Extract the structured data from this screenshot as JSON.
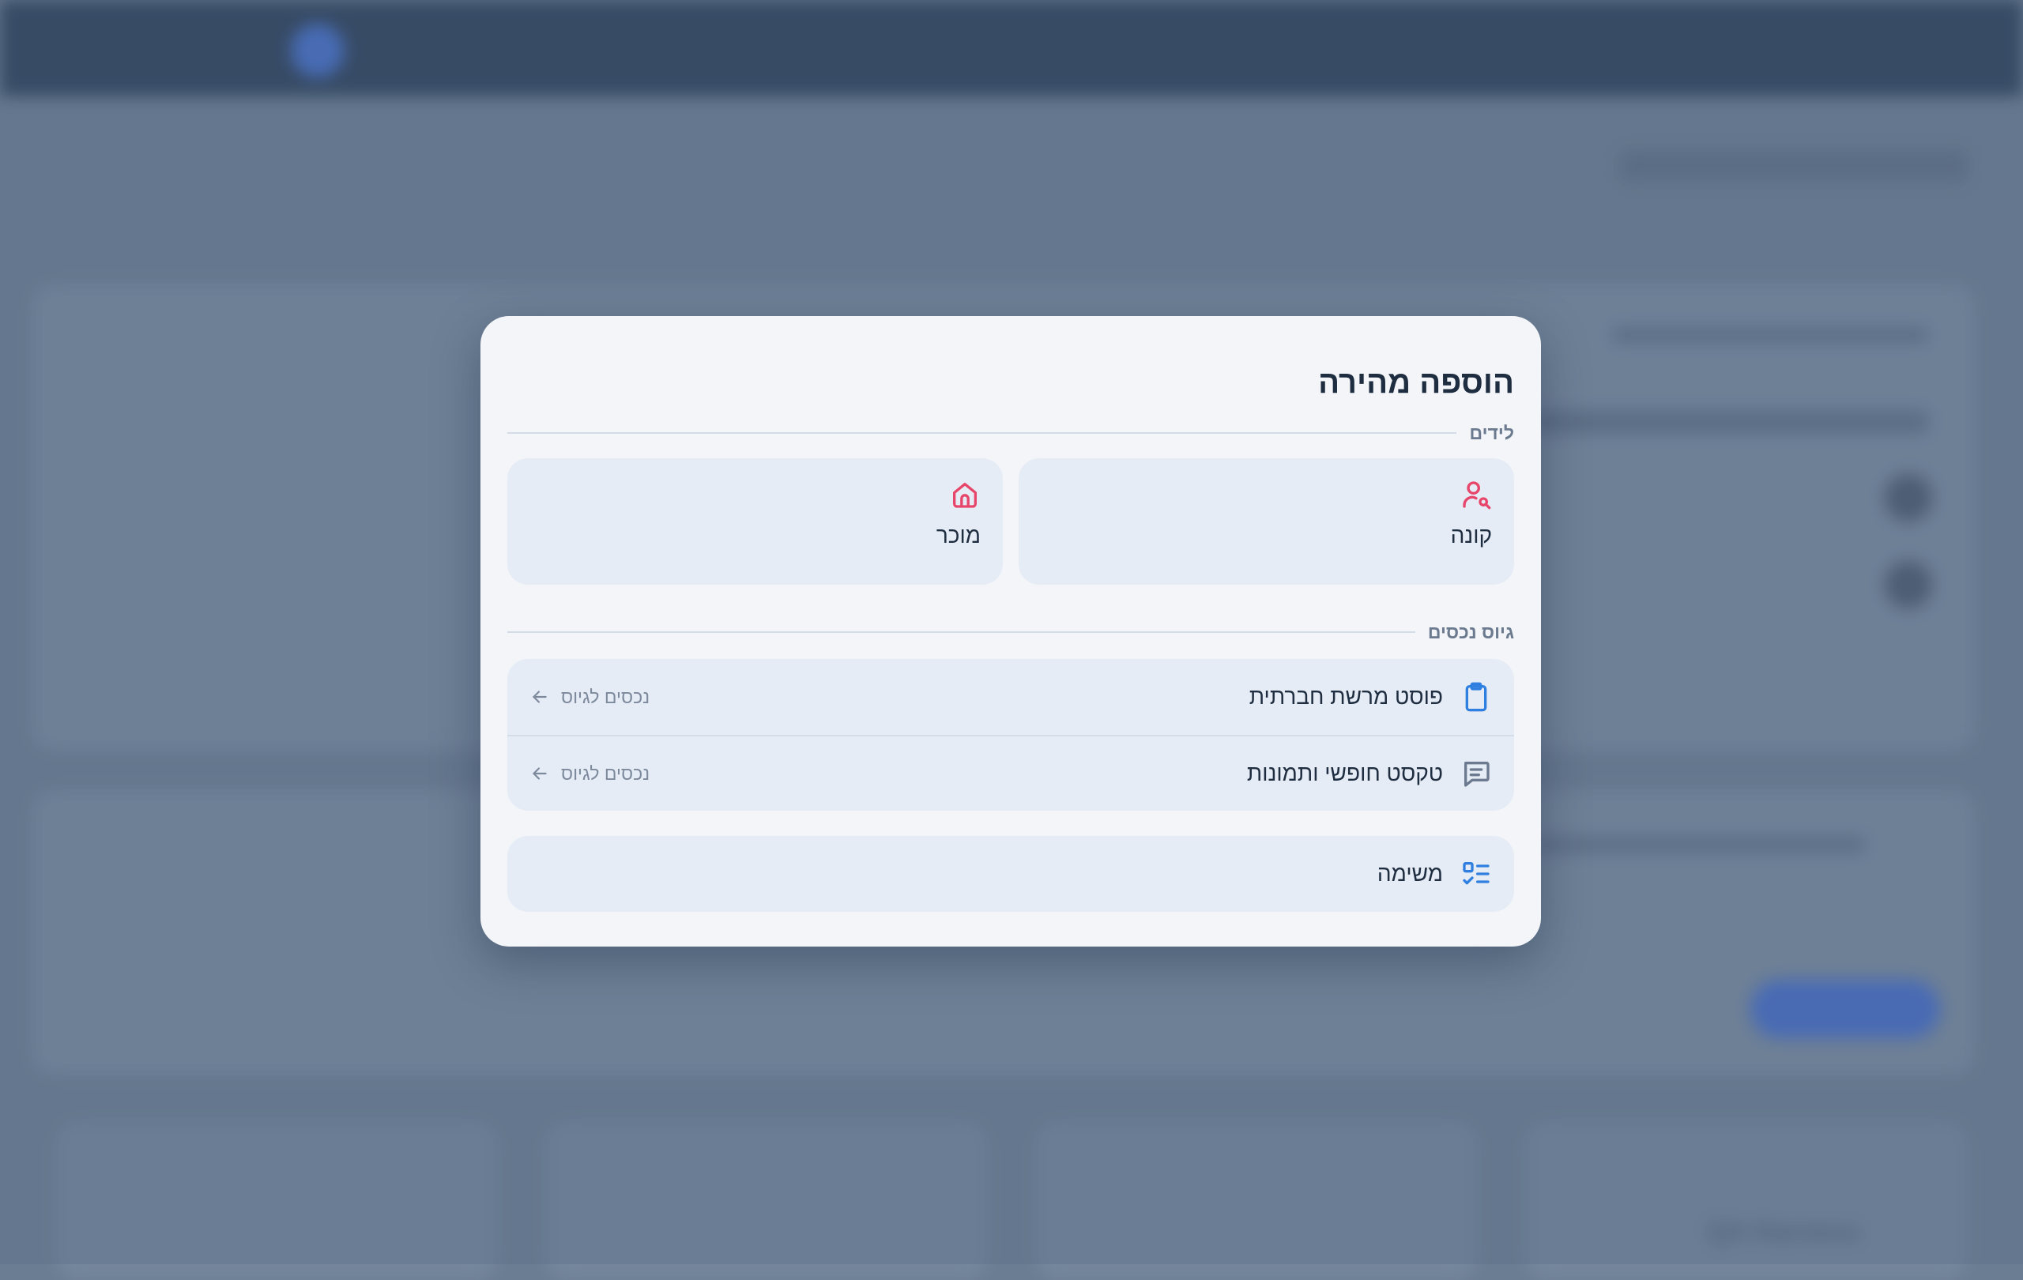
{
  "modal": {
    "title": "הוספה מהירה",
    "leads_section": "לידים",
    "leads": [
      {
        "label": "קונה",
        "icon": "user-search-icon"
      },
      {
        "label": "מוכר",
        "icon": "home-icon"
      }
    ],
    "assets_section": "גיוס נכסים",
    "assets": [
      {
        "label": "פוסט מרשת חברתית",
        "action": "נכסים לגיוס",
        "icon": "clipboard-icon"
      },
      {
        "label": "טקסט חופשי ותמונות",
        "action": "נכסים לגיוס",
        "icon": "message-lines-icon"
      }
    ],
    "task": {
      "label": "משימה",
      "icon": "checklist-icon"
    }
  },
  "background": {
    "blurred_label": "QA Harness"
  },
  "colors": {
    "lead_icon": "#e8456a",
    "asset_icon": "#2f7fe0",
    "title": "#1f2d40",
    "muted": "#7d8a9d"
  }
}
